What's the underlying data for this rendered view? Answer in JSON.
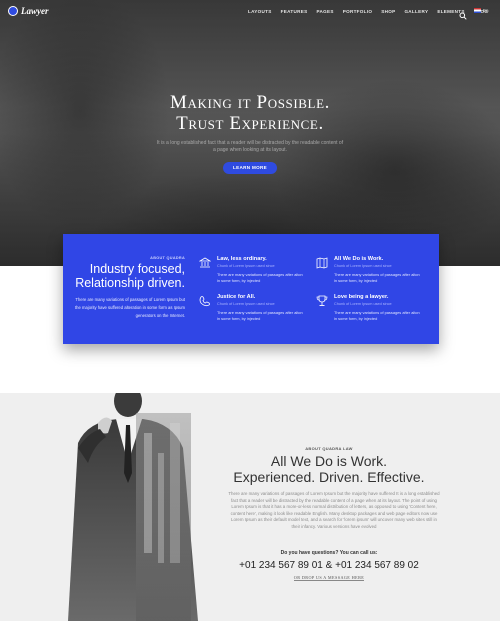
{
  "nav": {
    "logo_text": "Lawyer",
    "items": [
      "LAYOUTS",
      "FEATURES",
      "PAGES",
      "PORTFOLIO",
      "SHOP",
      "GALLERY",
      "ELEMENTS",
      "BLOG"
    ],
    "lang": "En",
    "icons": {
      "search": "search-icon",
      "flag": "flag-icon"
    }
  },
  "hero": {
    "title_line1": "Making it Possible.",
    "title_line2": "Trust Experience.",
    "subtitle": "It is a long established fact that a reader will be distracted by the readable content of a page when looking at its layout.",
    "button": "LEARN MORE"
  },
  "features": {
    "eyebrow": "ABOUT QUADRA",
    "title": "Industry focused, Relationship driven.",
    "text": "There are many variations of passages of Lorem Ipsum but the majority have suffered alteration in some form as Ipsum generators on the Internet.",
    "items": [
      {
        "heading": "Law, less ordinary.",
        "sub": "Chunk of Lorem Ipsum used since",
        "text": "There are many variations of passages after alton in some form, by injected",
        "icon": "law-icon"
      },
      {
        "heading": "All We Do is Work.",
        "sub": "Chunk of Lorem Ipsum used since",
        "text": "There are many variations of passages after alton in some form, by injected",
        "icon": "map-icon"
      },
      {
        "heading": "Justice for All.",
        "sub": "Chunk of Lorem Ipsum used since",
        "text": "There are many variations of passages after alton in some form, by injected",
        "icon": "phone-icon"
      },
      {
        "heading": "Love being a lawyer.",
        "sub": "Chunk of Lorem Ipsum used since",
        "text": "There are many variations of passages after alton in some form, by injected",
        "icon": "trophy-icon"
      }
    ]
  },
  "about": {
    "eyebrow": "ABOUT QUADRA LAW",
    "title_line1": "All We Do is Work.",
    "title_line2": "Experienced. Driven. Effective.",
    "text": "There are many variations of passages of Lorem Ipsum but the majority have suffered It is a long established fact that a reader will be distracted by the readable content of a page when at its layout. The point of using Lorem Ipsum is that it has a more-or-less normal distribution of letters, as opposed to using 'Content here, content here', making it look like readable English. Many desktop packages and web page editors now use Lorem Ipsum as their default model text, and a search for 'lorem ipsum' will uncover many web sites still in their infancy. Various versions have evolved",
    "question": "Do you have questions? You can call us:",
    "phone1": "+01 234 567 89 01",
    "amp": "&",
    "phone2": "+01 234 567 89 02",
    "drop": "OR DROP US A MESSAGE HERE"
  },
  "colors": {
    "accent": "#3046e6",
    "hero_dark": "#4b4b4b",
    "section_bg": "#efefef"
  }
}
